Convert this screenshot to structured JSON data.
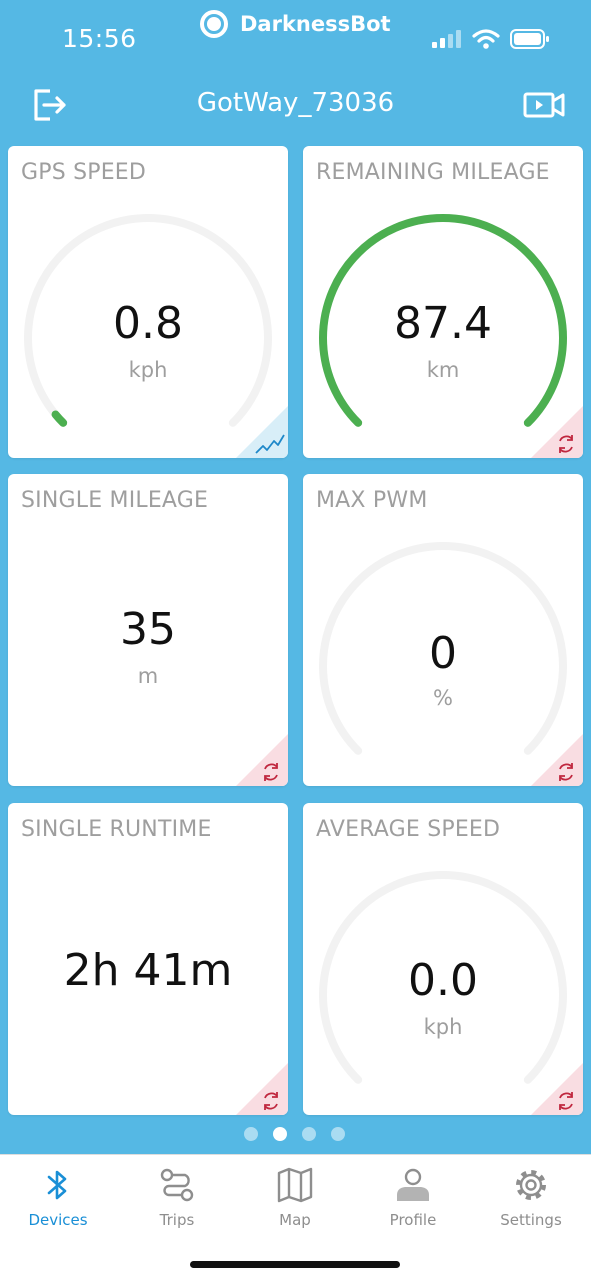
{
  "status_bar": {
    "time": "15:56",
    "app_name": "DarknessBot"
  },
  "header": {
    "title": "GotWay_73036",
    "left_icon": "logout-icon",
    "right_icon": "video-camera-icon"
  },
  "cards": [
    {
      "title": "GPS SPEED",
      "value": "0.8",
      "unit": "kph",
      "gauge_fraction": 0.02,
      "corner_icon": "chart-line-icon"
    },
    {
      "title": "REMAINING MILEAGE",
      "value": "87.4",
      "unit": "km",
      "gauge_fraction": 1.0,
      "corner_icon": "refresh-icon"
    },
    {
      "title": "SINGLE MILEAGE",
      "value": "35",
      "unit": "m",
      "corner_icon": "refresh-icon"
    },
    {
      "title": "MAX PWM",
      "value": "0",
      "unit": "%",
      "gauge_fraction": 0,
      "corner_icon": "refresh-icon"
    },
    {
      "title": "SINGLE RUNTIME",
      "value": "2h 41m",
      "unit": "",
      "corner_icon": "refresh-icon"
    },
    {
      "title": "AVERAGE SPEED",
      "value": "0.0",
      "unit": "kph",
      "gauge_fraction": 0,
      "corner_icon": "refresh-icon"
    }
  ],
  "pagination": {
    "pages": 4,
    "current": 2
  },
  "tabs": [
    {
      "label": "Devices",
      "icon": "bluetooth-icon",
      "active": true
    },
    {
      "label": "Trips",
      "icon": "route-icon",
      "active": false
    },
    {
      "label": "Map",
      "icon": "map-icon",
      "active": false
    },
    {
      "label": "Profile",
      "icon": "person-icon",
      "active": false
    },
    {
      "label": "Settings",
      "icon": "gear-icon",
      "active": false
    }
  ],
  "colors": {
    "background": "#55b8e4",
    "gauge_green": "#4caf50",
    "gauge_track": "#f2f2f2",
    "tab_active": "#1a8fd6",
    "corner_blue": "#d8eef8",
    "corner_red": "#f9dde2"
  }
}
